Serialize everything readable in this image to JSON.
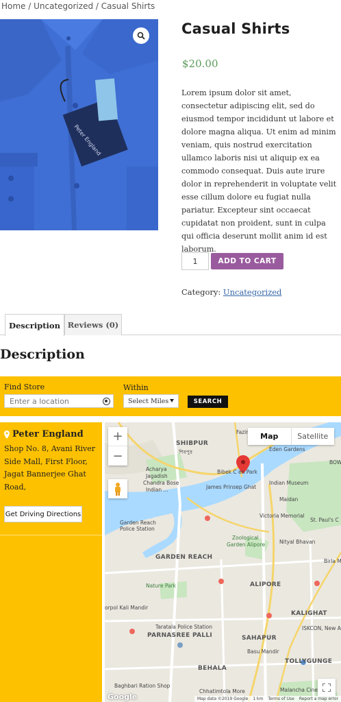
{
  "breadcrumb": {
    "home": "Home",
    "sep1": " / ",
    "category": "Uncategorized",
    "sep2": " / ",
    "current": "Casual Shirts"
  },
  "product": {
    "title": "Casual Shirts",
    "price": "$20.00",
    "description": "Lorem ipsum dolor sit amet, consectetur adipiscing elit, sed do eiusmod tempor incididunt ut labore et dolore magna aliqua. Ut enim ad minim veniam, quis nostrud exercitation ullamco laboris nisi ut aliquip ex ea commodo consequat. Duis aute irure dolor in reprehenderit in voluptate velit esse cillum dolore eu fugiat nulla pariatur. Excepteur sint occaecat cupidatat non proident, sunt in culpa qui officia deserunt mollit anim id est laborum.",
    "quantity": "1",
    "add_to_cart": "ADD TO CART",
    "category_label": "Category:",
    "category_link": "Uncategorized",
    "tag_text": "Peter England"
  },
  "tabs": [
    {
      "label": "Description"
    },
    {
      "label": "Reviews (0)"
    }
  ],
  "section_title": "Description",
  "store_locator": {
    "find_store_label": "Find Store",
    "location_placeholder": "Enter a location",
    "within_label": "Within",
    "miles_selected": "Select Miles",
    "search_label": "SEARCH",
    "store": {
      "name": "Peter England",
      "address": "Shop No. 8, Avani River Side Mall, First Floor, Jagat Bannerjee Ghat Road,",
      "directions_label": "Get Driving Directions"
    }
  },
  "map": {
    "map_type_map": "Map",
    "map_type_satellite": "Satellite",
    "zoom_in": "+",
    "zoom_out": "−",
    "logo": "Google",
    "footer": {
      "data": "Map data ©2019 Google",
      "scale": "1 km",
      "terms": "Terms of Use",
      "report": "Report a map error"
    },
    "labels": {
      "fazir": "Fazir Bazar",
      "shibpur": "SHIBPUR",
      "shibpur_bn": "শিবপুর",
      "eden": "Eden Gardens",
      "bow": "BOW",
      "acharya": "Acharya",
      "jagadish": "Jagadish",
      "chandra": "Chandra Bose",
      "indian_bot": "Indian ...",
      "bibek": "Bibek C   en Park",
      "prinsep": "James Prinsep Ghat",
      "museum": "Indian Museum",
      "maidan": "Maidan",
      "stpaul": "St. Paul's C",
      "victoria": "Victoria Memorial",
      "garden_reach_ps": "Garden Reach",
      "police_station": "Police Station",
      "zoological": "Zoological",
      "alipore_garden": "Garden Alipore",
      "nitya": "Nityal Bhavan",
      "birla": "Birla Mu",
      "garden_reach": "GARDEN REACH",
      "nature_park": "Nature Park",
      "alipore": "ALIPORE",
      "kali_mandir": "orpol Kali Mandir",
      "kalighat": "KALIGHAT",
      "taratala": "Taratala Police Station",
      "sahapur": "SAHAPUR",
      "iskcon": "ISKCON, New Ali",
      "parnasree": "PARNASREE PALLI",
      "basu": "Basu Mandir",
      "tollygunge": "TOLLYGUNGE",
      "behala": "BEHALA",
      "baghbari": "Baghbari Ration Shop",
      "chhatimtola": "Chhatimtola More",
      "malancha": "Malancha Cinema"
    }
  },
  "colors": {
    "accent_yellow": "#fdc100",
    "button_purple": "#9a5b9e",
    "price_green": "#5b9a5b",
    "link_blue": "#3567a8",
    "shirt_blue": "#3f6fd4"
  }
}
